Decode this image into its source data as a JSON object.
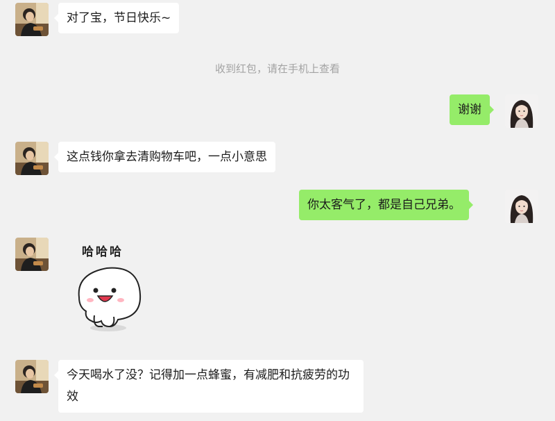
{
  "messages": [
    {
      "text": "对了宝，节日快乐~"
    },
    {
      "text": "收到红包，请在手机上查看"
    },
    {
      "text": "谢谢"
    },
    {
      "text": "这点钱你拿去清购物车吧，一点小意思"
    },
    {
      "text": "你太客气了，都是自己兄弟。"
    },
    {
      "sticker_text": "哈哈哈",
      "sticker_icon": "laughing-bun-sticker"
    },
    {
      "text": "今天喝水了没？记得加一点蜂蜜，有减肥和抗疲劳的功效"
    }
  ],
  "colors": {
    "background": "#f1f1f1",
    "incoming_bubble": "#ffffff",
    "outgoing_bubble": "#95ec69",
    "system_text": "#a3a3a3"
  }
}
